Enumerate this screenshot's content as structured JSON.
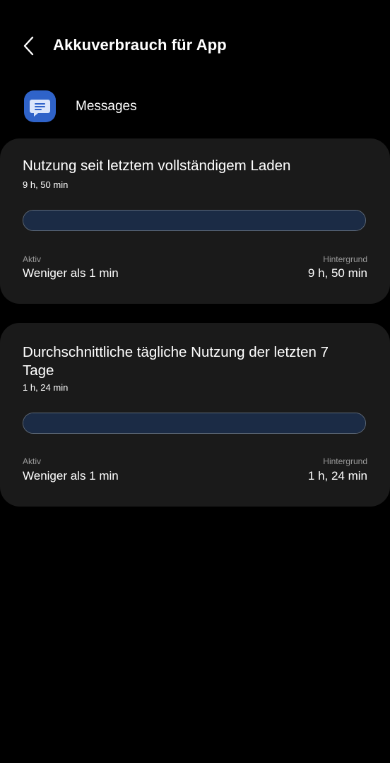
{
  "header": {
    "back_icon": "chevron-left-icon",
    "title": "Akkuverbrauch für App"
  },
  "app": {
    "icon": "messages-icon",
    "icon_color": "#2f63c9",
    "name": "Messages"
  },
  "cards": [
    {
      "title": "Nutzung seit letztem vollständigem Laden",
      "total": "9 h, 50 min",
      "bar_fill_fraction": 1.0,
      "active_label": "Aktiv",
      "active_value": "Weniger als 1 min",
      "background_label": "Hintergrund",
      "background_value": "9 h, 50 min"
    },
    {
      "title": "Durchschnittliche tägliche Nutzung der letzten 7 Tage",
      "total": "1 h, 24 min",
      "bar_fill_fraction": 1.0,
      "active_label": "Aktiv",
      "active_value": "Weniger als 1 min",
      "background_label": "Hintergrund",
      "background_value": "1 h, 24 min"
    }
  ],
  "colors": {
    "background": "#000000",
    "card": "#1a1a1a",
    "bar_fill": "#1b2b45",
    "bar_border": "#5c6878",
    "secondary_text": "#9a9a9a"
  }
}
